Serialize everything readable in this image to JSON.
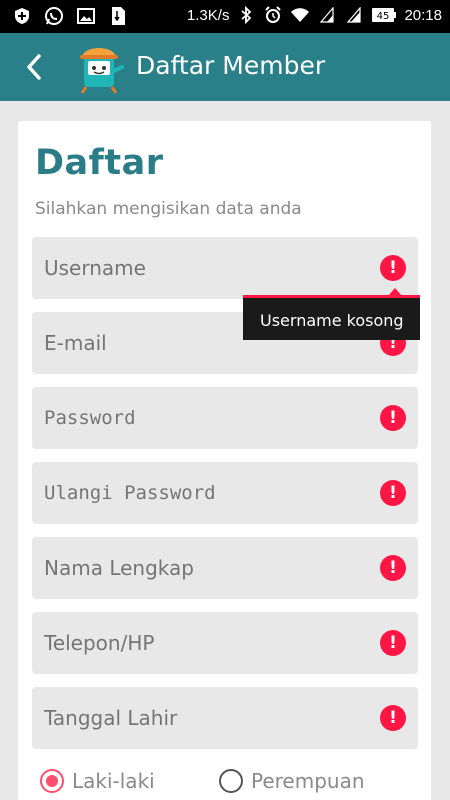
{
  "status_bar": {
    "left_icons": [
      "shield-plus-icon",
      "whatsapp-icon",
      "image-icon",
      "file-icon"
    ],
    "network_speed": "1.3K/s",
    "right_icons": [
      "bluetooth-icon",
      "alarm-icon",
      "wifi-icon",
      "signal-icon",
      "signal-icon",
      "battery-icon"
    ],
    "battery_level": "45",
    "time": "20:18"
  },
  "app_bar": {
    "back_icon": "chevron-left-icon",
    "logo_icon": "mascot-logo-icon",
    "title": "Daftar Member"
  },
  "form": {
    "title": "Daftar",
    "subtitle": "Silahkan mengisikan data anda",
    "fields": [
      {
        "placeholder": "Username",
        "error_icon": "alert-icon"
      },
      {
        "placeholder": "E-mail",
        "error_icon": "alert-icon"
      },
      {
        "placeholder": "Password",
        "error_icon": "alert-icon"
      },
      {
        "placeholder": "Ulangi Password",
        "error_icon": "alert-icon"
      },
      {
        "placeholder": "Nama Lengkap",
        "error_icon": "alert-icon"
      },
      {
        "placeholder": "Telepon/HP",
        "error_icon": "alert-icon"
      },
      {
        "placeholder": "Tanggal Lahir",
        "error_icon": "alert-icon"
      }
    ],
    "error_tooltip": "Username kosong",
    "gender_options": [
      {
        "label": "Laki-laki",
        "selected": true
      },
      {
        "label": "Perempuan",
        "selected": false
      }
    ]
  },
  "colors": {
    "app_bar": "#2a8088",
    "title": "#2a7d86",
    "error": "#ff1644",
    "radio_selected": "#ff4d6d"
  }
}
